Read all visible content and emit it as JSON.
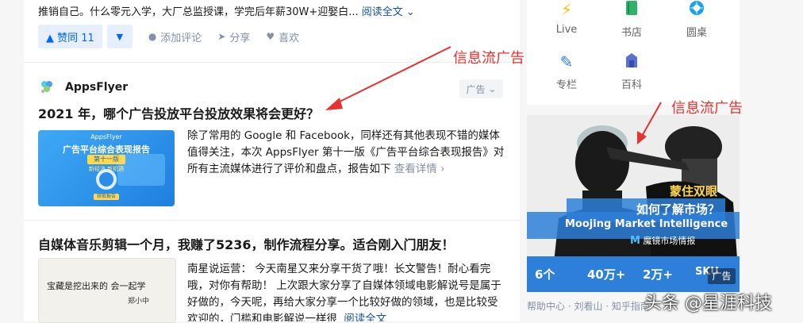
{
  "top_item": {
    "excerpt": "推销自己。什么零元入学，大厂总监授课，学完后年薪30W+迎娶白...",
    "read_more": "阅读全文",
    "vote_up_label": "▲ 赞同 11",
    "vote_down_label": "▼",
    "comment_label": "添加评论",
    "share_label": "分享",
    "like_label": "喜欢"
  },
  "ad_item": {
    "brand": "AppsFlyer",
    "ad_tag": "广告",
    "title": "2021 年，哪个广告投放平台投放效果将会更好？",
    "body": "除了常用的 Google 和 Facebook，同样还有其他表现不错的媒体值得关注，本次 AppsFlyer 第十一版《广告平台综合表现报告》对所有主流媒体进行了评价和盘点，报告如下",
    "detail_link": "查看详情",
    "thumb": {
      "logo": "AppsFlyer",
      "heading": "广告平台综合表现报告",
      "edition": "第十一版",
      "sub": "新经济 新机遇",
      "button": "获取报告"
    }
  },
  "third_item": {
    "title": "自媒体音乐剪辑一个月，我赚了5236，制作流程分享。适合刚入门朋友！",
    "body": "南星说运营： 今天南星又来分享干货了哦！长文警告！耐心看完哦，对你有帮助！ 上次跟大家分享了自媒体领域电影解说号是属于好做的，今天呢，再给大家分享一个比较好做的领域，也是比较受欢迎的，门槛和电影解说一样很",
    "read_more": "阅读全文",
    "thumb_text": "宝藏是挖出来的 会一起学",
    "thumb_sign": "郑小中"
  },
  "annotations": {
    "feed_ad": "信息流广告",
    "sidebar_ad": "信息流广告"
  },
  "sidebar": {
    "items": [
      {
        "label": "Live",
        "icon": "lightning-icon"
      },
      {
        "label": "书店",
        "icon": "book-icon"
      },
      {
        "label": "圆桌",
        "icon": "roundtable-icon"
      },
      {
        "label": "专栏",
        "icon": "pen-icon"
      },
      {
        "label": "百科",
        "icon": "encyclopedia-icon"
      }
    ],
    "ad_banner": {
      "headline1": "蒙住双眼",
      "headline2": "如何了解市场？",
      "english": "Moojing Market Intelligence",
      "brand_cn": "魔镜市场情报",
      "stats": [
        "6个",
        "40万+",
        "2万+",
        "SKU"
      ],
      "tag": "广告"
    },
    "footer": "帮助中心 · 刘看山 · 知乎指南"
  },
  "watermark": "头条 @星涯科技",
  "colors": {
    "accent": "#0066ff",
    "annotation": "#e8322f",
    "link": "#175199",
    "muted": "#8590a6"
  }
}
